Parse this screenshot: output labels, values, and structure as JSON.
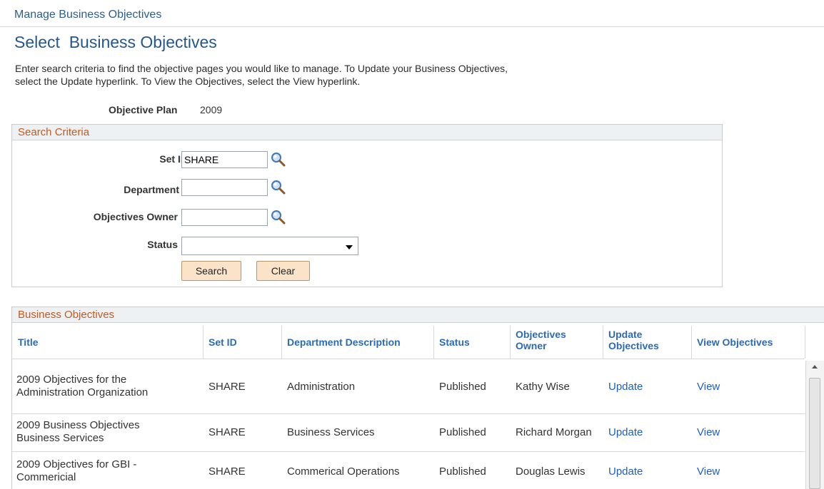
{
  "breadcrumb": "Manage Business Objectives",
  "page_title": "Select  Business Objectives",
  "instructions": [
    "Enter search criteria to find the objective pages you would like to manage. To Update your Business Objectives,",
    "select the Update hyperlink. To View the Objectives, select the View hyperlink."
  ],
  "objective_plan": {
    "label": "Objective Plan",
    "value": "2009"
  },
  "search": {
    "header": "Search Criteria",
    "setid_label": "Set ID",
    "setid_value": "SHARE",
    "department_label": "Department",
    "department_value": "",
    "owner_label": "Objectives Owner",
    "owner_value": "",
    "status_label": "Status",
    "status_value": "",
    "search_button": "Search",
    "clear_button": "Clear",
    "lookup_icon": "magnifier-lookup-icon"
  },
  "grid": {
    "header": "Business Objectives",
    "columns": {
      "title": "Title",
      "setid": "Set ID",
      "dept": "Department Description",
      "status": "Status",
      "owner_1": "Objectives",
      "owner_2": "Owner",
      "update_1": "Update",
      "update_2": "Objectives",
      "view": "View Objectives"
    },
    "rows": [
      {
        "title_1": "2009 Objectives for the",
        "title_2": "Administration Organization",
        "setid": "SHARE",
        "dept": "Administration",
        "status": "Published",
        "owner": "Kathy Wise",
        "update": "Update",
        "view": "View"
      },
      {
        "title_1": "2009 Business Objectives",
        "title_2": "Business Services",
        "setid": "SHARE",
        "dept": "Business Services",
        "status": "Published",
        "owner": "Richard Morgan",
        "update": "Update",
        "view": "View"
      },
      {
        "title_1": "2009 Objectives for GBI -",
        "title_2": "Commericial",
        "setid": "SHARE",
        "dept": "Commerical Operations",
        "status": "Published",
        "owner": "Douglas Lewis",
        "update": "Update",
        "view": "View"
      }
    ]
  },
  "colors": {
    "accent_orange": "#c6591c",
    "link_blue": "#1d5ec9",
    "title_blue": "#24578e",
    "button_fill": "#fbe3c9"
  }
}
